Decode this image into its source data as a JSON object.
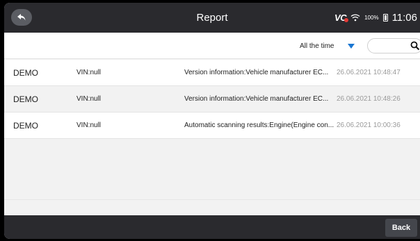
{
  "header": {
    "title": "Report",
    "back_icon": "back-arrow-icon",
    "status": {
      "vci_logo": "VC",
      "battery_percent": "100%",
      "time": "11:06"
    }
  },
  "filters": {
    "time_range": "All the time",
    "search_placeholder": ""
  },
  "reports": [
    {
      "name": "DEMO",
      "vin": "VIN:null",
      "description": "Version information:Vehicle manufacturer EC...",
      "date": "26.06.2021 10:48:47"
    },
    {
      "name": "DEMO",
      "vin": "VIN:null",
      "description": "Version information:Vehicle manufacturer EC...",
      "date": "26.06.2021 10:48:26"
    },
    {
      "name": "DEMO",
      "vin": "VIN:null",
      "description": "Automatic scanning results:Engine(Engine con...",
      "date": "26.06.2021 10:00:36"
    }
  ],
  "footer": {
    "back_label": "Back"
  },
  "colors": {
    "topbar": "#2a2a2e",
    "accent": "#1976d2",
    "vci_dot": "#e53935",
    "date_text": "#9a9a9a"
  }
}
